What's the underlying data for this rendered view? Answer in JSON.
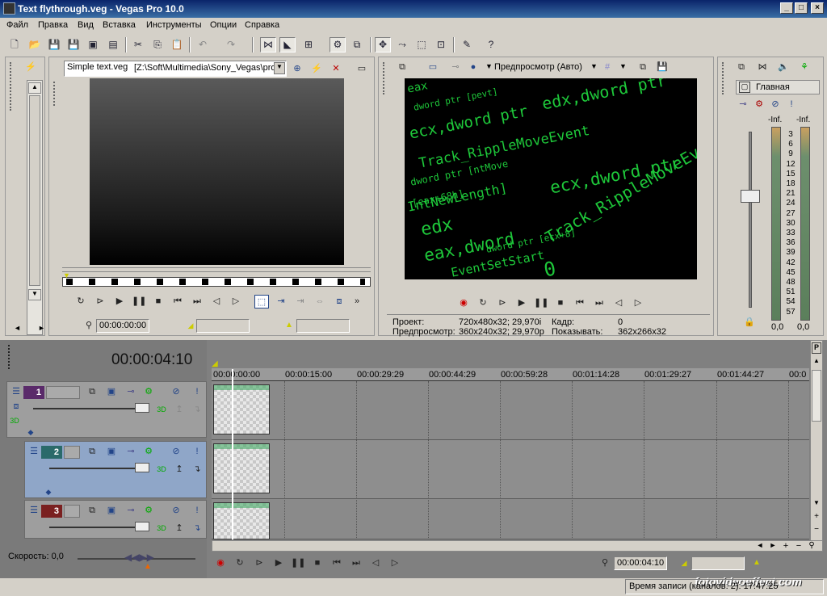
{
  "window": {
    "title": "Text flythrough.veg - Vegas Pro 10.0"
  },
  "menu": [
    "Файл",
    "Правка",
    "Вид",
    "Вставка",
    "Инструменты",
    "Опции",
    "Справка"
  ],
  "trimmer": {
    "file_label": "Simple text.veg",
    "path": "[Z:\\Soft\\Multimedia\\Sony_Vegas\\pro",
    "timecode": "00:00:00:00"
  },
  "preview": {
    "mode": "Предпросмотр (Авто)",
    "project_label": "Проект:",
    "project_value": "720x480x32; 29,970i",
    "frame_label": "Кадр:",
    "frame_value": "0",
    "preview_label": "Предпросмотр:",
    "preview_value": "360x240x32; 29,970p",
    "display_label": "Показывать:",
    "display_value": "362x266x32",
    "code_lines": [
      "eax",
      "dword ptr [pevt]",
      "ecx,dword ptr",
      "edx,dword ptr",
      "Track_RippleMoveEvent",
      "dword ptr [ntMove",
      "ecx,dword ptr",
      "[eax+68h]",
      "edx",
      "IntNewLength]",
      "Track_RippleMoveEvent",
      "dword ptr [ecx+8]",
      "EventSetStart",
      "eax,dword",
      "0"
    ]
  },
  "mixer": {
    "title": "Главная",
    "left_level": "-Inf.",
    "right_level": "-Inf.",
    "scale": [
      "3",
      "6",
      "9",
      "12",
      "15",
      "18",
      "21",
      "24",
      "27",
      "30",
      "33",
      "36",
      "39",
      "42",
      "45",
      "48",
      "51",
      "54",
      "57"
    ],
    "left_value": "0,0",
    "right_value": "0,0"
  },
  "timeline": {
    "cursor_time": "00:00:04:10",
    "ruler": [
      "00:00:00:00",
      "00:00:15:00",
      "00:00:29:29",
      "00:00:44:29",
      "00:00:59:28",
      "00:01:14:28",
      "00:01:29:27",
      "00:01:44:27",
      "00:0"
    ],
    "tracks": [
      {
        "number": "1",
        "color": "#5a2a6a"
      },
      {
        "number": "2",
        "color": "#2a6a6a"
      },
      {
        "number": "3",
        "color": "#7a2020"
      }
    ],
    "speed_label": "Скорость: 0,0",
    "transport_time": "00:00:04:10"
  },
  "status": {
    "record_time": "Время записи (каналов: 2): 17:47:25"
  },
  "watermark": "fotovideoeffect.com"
}
